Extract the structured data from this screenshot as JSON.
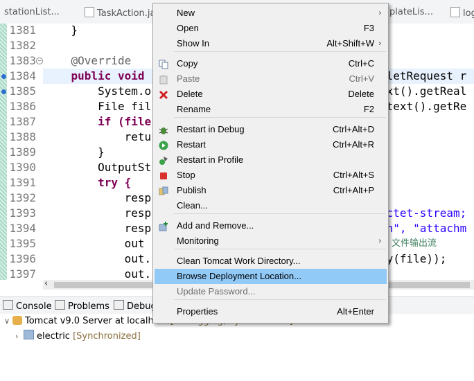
{
  "editor_tabs": [
    "stationList...",
    "TaskAction.jav",
    "plateLis...",
    "log"
  ],
  "code_lines": [
    {
      "num": "1381",
      "code": "    }"
    },
    {
      "num": "1382",
      "code": ""
    },
    {
      "num": "1383",
      "code": "    @Override"
    },
    {
      "num": "1384",
      "code": "    public void"
    },
    {
      "num": "1385",
      "code": "        System.o"
    },
    {
      "num": "1386",
      "code": "        File fil"
    },
    {
      "num": "1387",
      "code": "        if (file"
    },
    {
      "num": "1388",
      "code": "            retu"
    },
    {
      "num": "1389",
      "code": "        }"
    },
    {
      "num": "1390",
      "code": "        OutputSt"
    },
    {
      "num": "1391",
      "code": "        try {"
    },
    {
      "num": "1392",
      "code": "            resp"
    },
    {
      "num": "1393",
      "code": "            resp"
    },
    {
      "num": "1394",
      "code": "            resp"
    },
    {
      "num": "1395",
      "code": "            out"
    },
    {
      "num": "1396",
      "code": "            out."
    },
    {
      "num": "1397",
      "code": "            out."
    }
  ],
  "code_right": [
    {
      "row": 3,
      "text": "vletRequest r"
    },
    {
      "row": 4,
      "text": "ext().getReal"
    },
    {
      "row": 5,
      "text": "ntext().getRe"
    },
    {
      "row": 12,
      "text": "octet-stream;"
    },
    {
      "row": 13,
      "text": "on\", \"attachm"
    },
    {
      "row": 14,
      "text": "文件输出流"
    },
    {
      "row": 15,
      "text": "ay(file));"
    }
  ],
  "view_tabs": [
    "Console",
    "Problems",
    "Debug"
  ],
  "servers": {
    "server_name": "Tomcat v9.0 Server at localhost",
    "server_state": "[Debugging, Synchronized]",
    "project_name": "electric",
    "project_state": "[Synchronized]"
  },
  "menu": {
    "items": [
      {
        "label": "New",
        "shortcut": "",
        "submenu": true,
        "icon": ""
      },
      {
        "label": "Open",
        "shortcut": "F3",
        "icon": ""
      },
      {
        "label": "Show In",
        "shortcut": "Alt+Shift+W",
        "submenu": true,
        "icon": ""
      },
      {
        "label": "Copy",
        "shortcut": "Ctrl+C",
        "icon": "copy-icon"
      },
      {
        "label": "Paste",
        "shortcut": "Ctrl+V",
        "icon": "paste-icon",
        "disabled": true
      },
      {
        "label": "Delete",
        "shortcut": "Delete",
        "icon": "delete-icon"
      },
      {
        "label": "Rename",
        "shortcut": "F2",
        "icon": ""
      },
      {
        "label": "Restart in Debug",
        "shortcut": "Ctrl+Alt+D",
        "icon": "debug-bug-icon"
      },
      {
        "label": "Restart",
        "shortcut": "Ctrl+Alt+R",
        "icon": "run-icon"
      },
      {
        "label": "Restart in Profile",
        "shortcut": "",
        "icon": "profile-icon"
      },
      {
        "label": "Stop",
        "shortcut": "Ctrl+Alt+S",
        "icon": "stop-icon"
      },
      {
        "label": "Publish",
        "shortcut": "Ctrl+Alt+P",
        "icon": "publish-icon"
      },
      {
        "label": "Clean...",
        "shortcut": "",
        "icon": ""
      },
      {
        "label": "Add and Remove...",
        "shortcut": "",
        "icon": "add-remove-icon"
      },
      {
        "label": "Monitoring",
        "shortcut": "",
        "submenu": true,
        "icon": ""
      },
      {
        "label": "Clean Tomcat Work Directory...",
        "shortcut": "",
        "icon": ""
      },
      {
        "label": "Browse Deployment Location...",
        "shortcut": "",
        "icon": "",
        "selected": true
      },
      {
        "label": "Update Password...",
        "shortcut": "",
        "icon": "",
        "disabled": true
      },
      {
        "label": "Properties",
        "shortcut": "Alt+Enter",
        "icon": ""
      }
    ],
    "submenu_glyph": "›"
  },
  "colors": {
    "menu_highlight": "#91c9f7",
    "keyword": "#7f0055",
    "string": "#2a00ff",
    "annotation": "#646464"
  }
}
